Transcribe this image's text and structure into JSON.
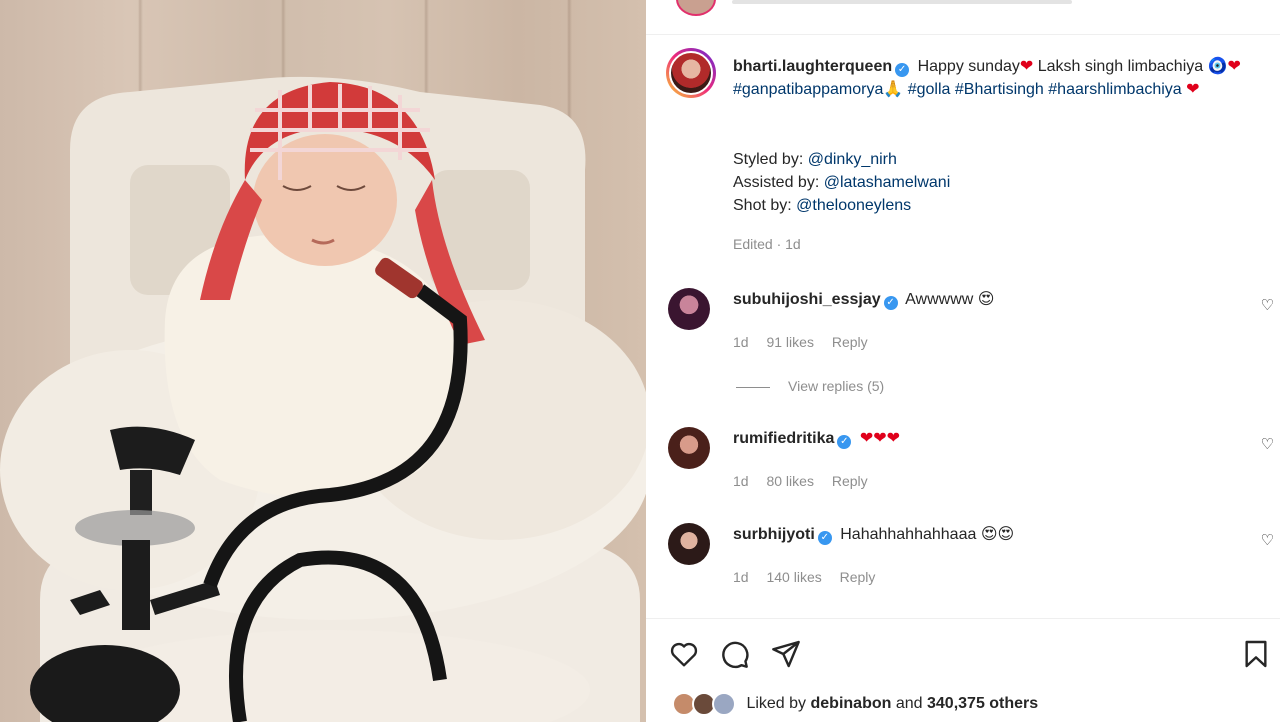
{
  "post": {
    "author": "bharti.laughterqueen",
    "caption_text_1": "Happy sunday",
    "caption_text_2": "Laksh singh limbachiya",
    "hashtag_1": "#ganpatibappamorya",
    "hashtag_2": "#golla",
    "hashtag_3": "#Bhartisingh",
    "hashtag_4": "#haarshlimbachiya",
    "styled_by_label": "Styled by:",
    "styled_by": "@dinky_nirh",
    "assisted_by_label": "Assisted by:",
    "assisted_by": "@latashamelwani",
    "shot_by_label": "Shot by:",
    "shot_by": "@thelooneylens",
    "edited": "Edited · 1d"
  },
  "comments": [
    {
      "user": "subuhijoshi_essjay",
      "text": "Awwwww",
      "emoji": "😍",
      "time": "1d",
      "likes": "91 likes",
      "reply": "Reply"
    },
    {
      "user": "rumifiedritika",
      "text": "",
      "emoji": "❤❤❤",
      "time": "1d",
      "likes": "80 likes",
      "reply": "Reply"
    },
    {
      "user": "surbhijyoti",
      "text": "Hahahhahhahhaaa",
      "emoji": "😍😍",
      "time": "1d",
      "likes": "140 likes",
      "reply": "Reply"
    }
  ],
  "view_replies": "View replies (5)",
  "likes_summary": {
    "prefix": "Liked by",
    "user": "debinabon",
    "middle": "and",
    "count": "340,375 others"
  },
  "icons": {
    "like": "heart-icon",
    "comment": "comment-bubble-icon",
    "share": "paper-plane-icon",
    "save": "bookmark-icon",
    "verified": "verified-badge-icon"
  },
  "colors": {
    "link": "#00376b",
    "verified": "#3897f0",
    "muted": "#8e8e8e",
    "heart": "#e0001b"
  }
}
